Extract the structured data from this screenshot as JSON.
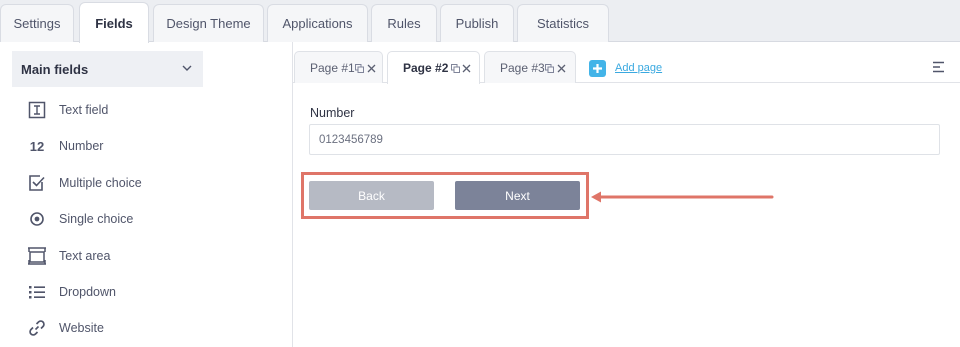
{
  "top_tabs": [
    {
      "label": "Settings",
      "active": false
    },
    {
      "label": "Fields",
      "active": true
    },
    {
      "label": "Design Theme",
      "active": false
    },
    {
      "label": "Applications",
      "active": false
    },
    {
      "label": "Rules",
      "active": false
    },
    {
      "label": "Publish",
      "active": false
    },
    {
      "label": "Statistics",
      "active": false
    }
  ],
  "sidebar": {
    "header": "Main fields",
    "items": [
      {
        "label": "Text field",
        "icon": "text-field-icon"
      },
      {
        "label": "Number",
        "icon": "number-icon",
        "glyph": "12"
      },
      {
        "label": "Multiple choice",
        "icon": "checkbox-icon"
      },
      {
        "label": "Single choice",
        "icon": "radio-icon"
      },
      {
        "label": "Text area",
        "icon": "text-area-icon"
      },
      {
        "label": "Dropdown",
        "icon": "list-icon"
      },
      {
        "label": "Website",
        "icon": "link-icon"
      }
    ]
  },
  "page_tabs": [
    {
      "label": "Page #1",
      "active": false
    },
    {
      "label": "Page #2",
      "active": true
    },
    {
      "label": "Page #3",
      "active": false
    }
  ],
  "add_page_label": "Add page",
  "form": {
    "field_label": "Number",
    "field_value": "0123456789",
    "back_label": "Back",
    "next_label": "Next"
  },
  "colors": {
    "accent": "#43b4e8",
    "highlight": "#df7568",
    "next_button": "#7c8399",
    "back_button": "#b6bac4"
  }
}
